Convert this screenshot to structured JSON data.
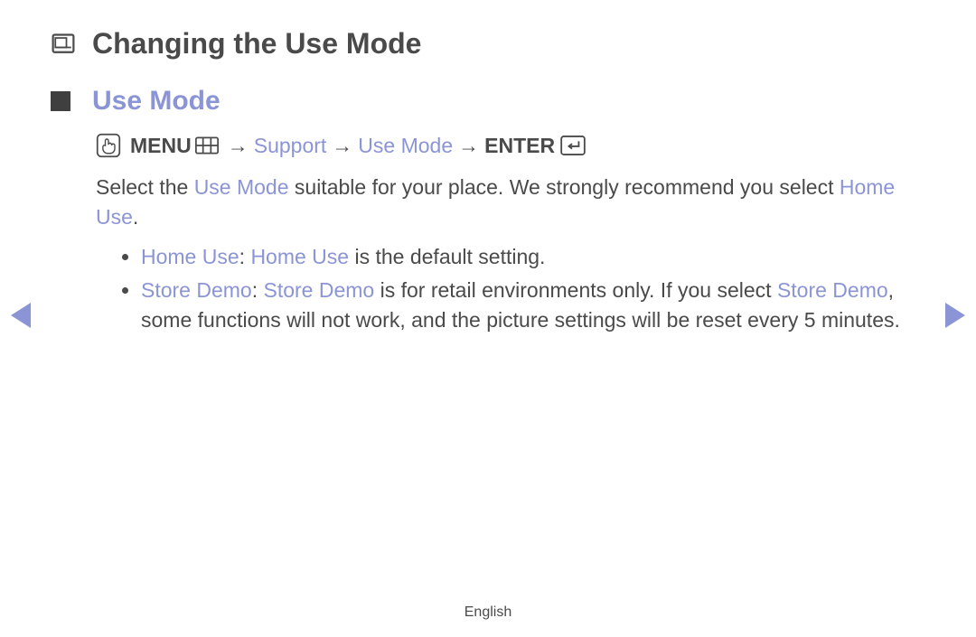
{
  "title": "Changing the Use Mode",
  "section_heading": "Use Mode",
  "breadcrumb": {
    "menu_label": "MENU",
    "support_label": "Support",
    "use_mode_label": "Use Mode",
    "enter_label": "ENTER",
    "arrow": "→"
  },
  "intro": {
    "p1a": "Select the ",
    "p1b": "Use Mode",
    "p1c": " suitable for your place. We strongly recommend you select ",
    "p1d": "Home Use",
    "p1e": "."
  },
  "bullets": {
    "b1a": "Home Use",
    "b1b": ": ",
    "b1c": "Home Use",
    "b1d": " is the default setting.",
    "b2a": "Store Demo",
    "b2b": ": ",
    "b2c": "Store Demo",
    "b2d": " is for retail environments only. If you select ",
    "b2e": "Store Demo",
    "b2f": ", some functions will not work, and the picture settings will be reset every 5 minutes."
  },
  "footer_language": "English"
}
